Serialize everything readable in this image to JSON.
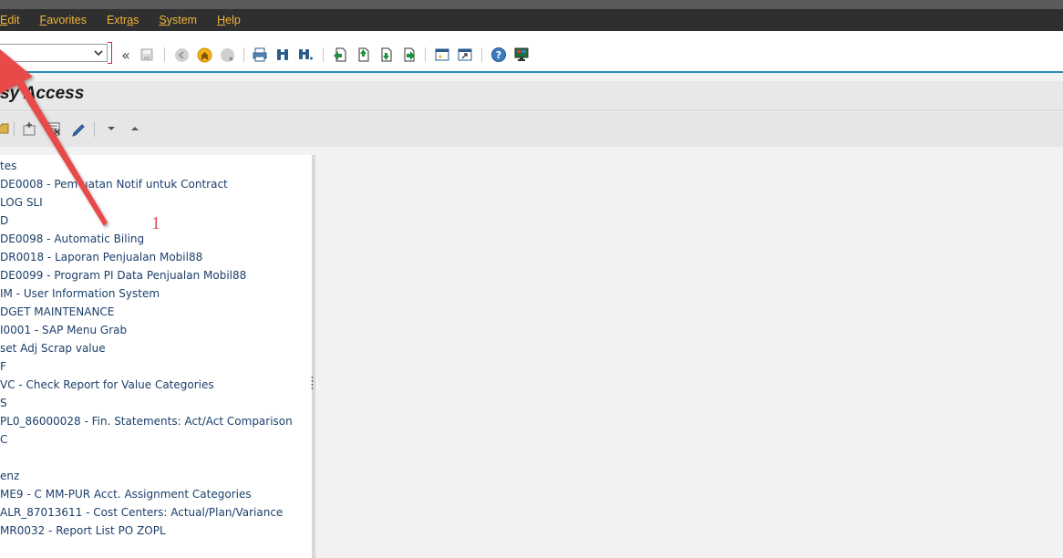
{
  "menubar": {
    "items": [
      {
        "pre": "",
        "acc": "E",
        "post": "dit"
      },
      {
        "pre": "",
        "acc": "F",
        "post": "avorites"
      },
      {
        "pre": "Extr",
        "acc": "a",
        "post": "s"
      },
      {
        "pre": "",
        "acc": "S",
        "post": "ystem"
      },
      {
        "pre": "",
        "acc": "H",
        "post": "elp"
      }
    ]
  },
  "toolbar": {
    "command_field_value": "",
    "collapse_label": "«"
  },
  "title": {
    "text": "sy Access"
  },
  "annotation": {
    "number": "1",
    "color": "#e84a4a"
  },
  "colors": {
    "menubar_text": "#f0b33a",
    "tree_text": "#1b3f6b",
    "toolbar_accent": "#2d8ab8"
  },
  "tree": {
    "items": [
      "tes",
      "DE0008 - Pem   uatan Notif untuk Contract",
      "LOG SLI",
      "D",
      "DE0098 - Automatic Biling",
      "DR0018 - Laporan Penjualan Mobil88",
      "DE0099 - Program PI Data Penjualan Mobil88",
      "IM - User Information System",
      "DGET MAINTENANCE",
      "I0001 - SAP Menu Grab",
      "set Adj Scrap value",
      "F",
      "VC - Check Report for Value Categories",
      "S",
      "PL0_86000028 - Fin. Statements: Act/Act Comparison",
      "C",
      "",
      "enz",
      "ME9 - C MM-PUR Acct. Assignment Categories",
      "ALR_87013611 - Cost Centers: Actual/Plan/Variance",
      "MR0032 - Report List PO ZOPL"
    ]
  }
}
